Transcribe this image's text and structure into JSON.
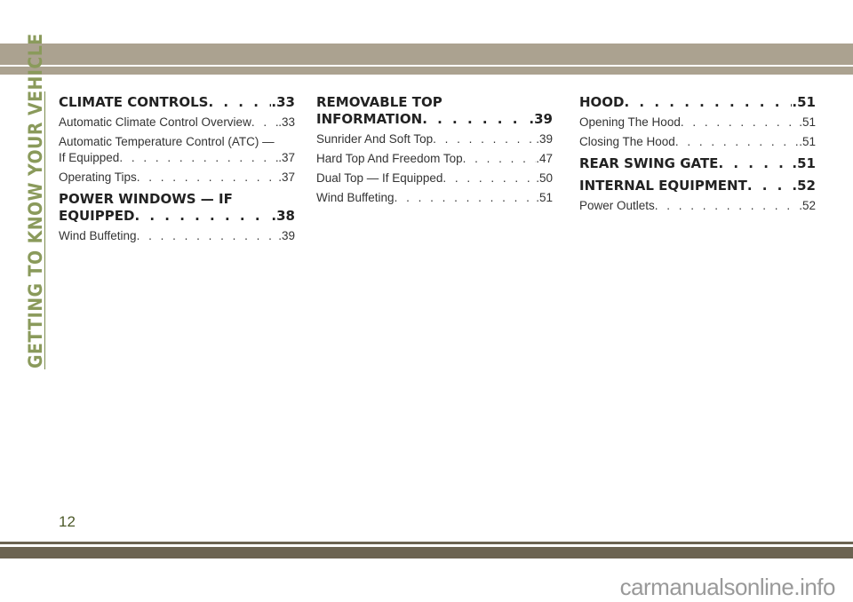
{
  "sidebar_title": "GETTING TO KNOW YOUR VEHICLE",
  "page_number": "12",
  "watermark": "carmanualsonline.info",
  "colors": {
    "band_top": "#aba290",
    "band_bottom": "#6b6351",
    "sidebar": "#8a9a5b"
  },
  "columns": [
    {
      "sections": [
        {
          "title": "CLIMATE CONTROLS",
          "page": ".33",
          "entries": [
            {
              "title": "Automatic Climate Control Overview",
              "page": ".33"
            },
            {
              "title_line1": "Automatic Temperature Control (ATC) —",
              "title": "If Equipped",
              "page": ".37"
            },
            {
              "title": "Operating Tips",
              "page": ".37"
            }
          ]
        },
        {
          "title_line1": "POWER WINDOWS — IF",
          "title": "EQUIPPED",
          "page": ".38",
          "entries": [
            {
              "title": "Wind Buffeting",
              "page": ".39"
            }
          ]
        }
      ]
    },
    {
      "sections": [
        {
          "title_line1": "REMOVABLE TOP",
          "title": "INFORMATION",
          "page": ".39",
          "entries": [
            {
              "title": "Sunrider And Soft Top",
              "page": ".39"
            },
            {
              "title": "Hard Top And Freedom Top",
              "page": ".47"
            },
            {
              "title": "Dual Top — If Equipped",
              "page": ".50"
            },
            {
              "title": "Wind Buffeting",
              "page": ".51"
            }
          ]
        }
      ]
    },
    {
      "sections": [
        {
          "title": "HOOD",
          "page": ".51",
          "entries": [
            {
              "title": "Opening The Hood",
              "page": ".51"
            },
            {
              "title": "Closing The Hood",
              "page": ".51"
            }
          ]
        },
        {
          "title": "REAR SWING GATE",
          "page": ".51",
          "entries": []
        },
        {
          "title": "INTERNAL EQUIPMENT",
          "page": ".52",
          "entries": [
            {
              "title": "Power Outlets",
              "page": ".52"
            }
          ]
        }
      ]
    }
  ]
}
